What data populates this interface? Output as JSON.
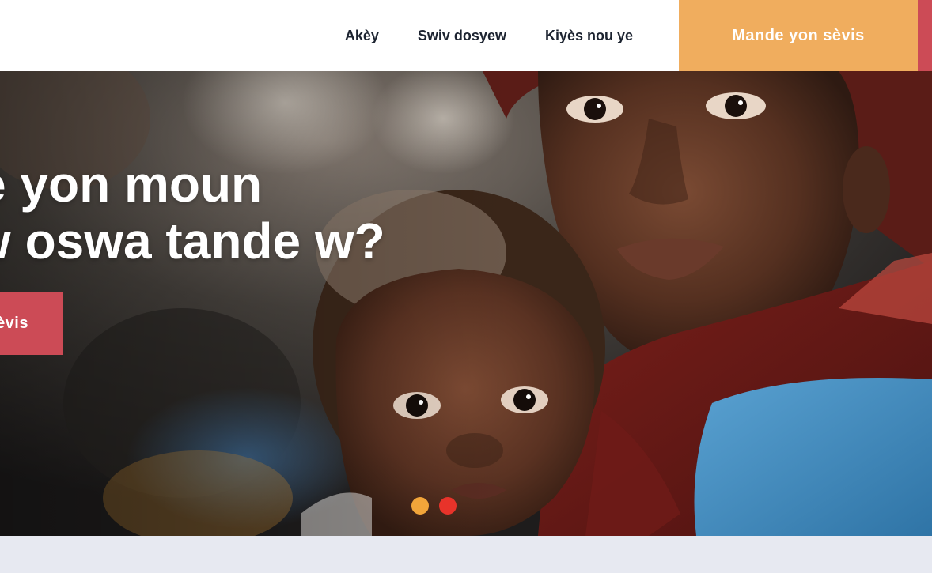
{
  "nav": {
    "items": [
      {
        "label": "Akèy"
      },
      {
        "label": "Swiv dosyew"
      },
      {
        "label": "Kiyès nou ye"
      }
    ],
    "cta_label": "Mande yon sèvis"
  },
  "hero": {
    "title_line1": "e yon moun",
    "title_line2": "w oswa tande w?",
    "cta_label": "èvis",
    "slides": {
      "count": 2,
      "active": 2
    }
  },
  "colors": {
    "nav_text": "#1c2330",
    "cta_top": "#f0ad5e",
    "accent_red": "#cc4b56",
    "dot_inactive": "#f2a53a",
    "dot_active": "#e8332a",
    "band": "#e7e9f1"
  }
}
